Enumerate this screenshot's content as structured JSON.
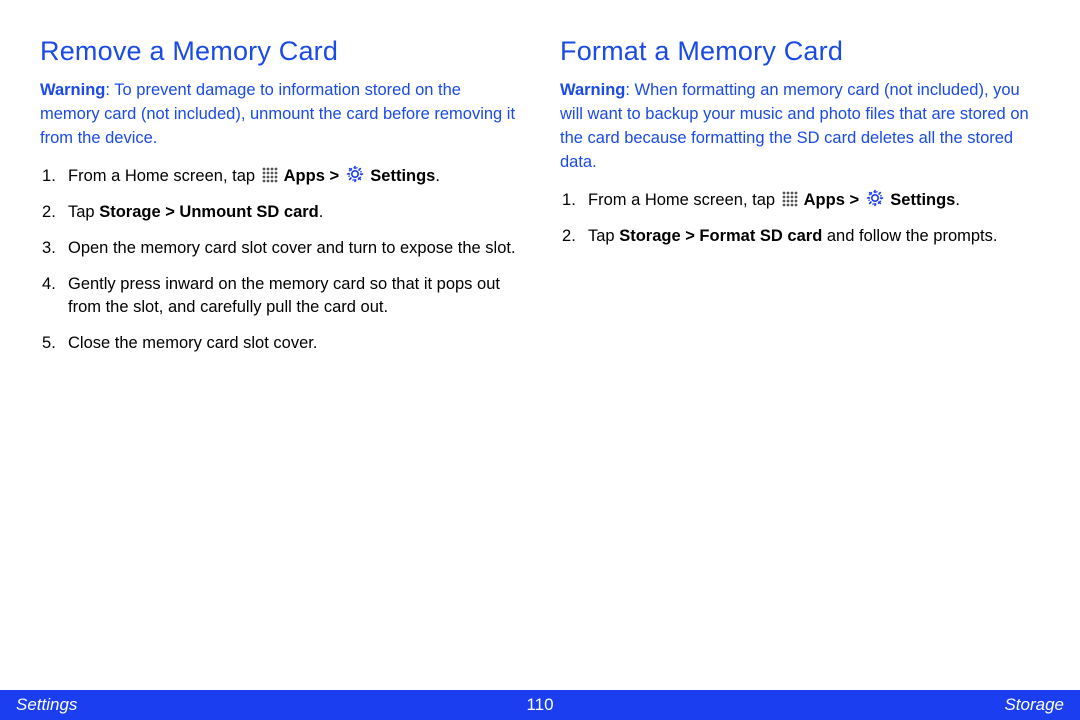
{
  "left": {
    "heading": "Remove a Memory Card",
    "warning_label": "Warning",
    "warning_text": ": To prevent damage to information stored on the memory card (not included), unmount the card before removing it from the device.",
    "steps": {
      "s1a": "From a Home screen, tap ",
      "s1b": " Apps > ",
      "s1c": " Settings",
      "s2a": "Tap ",
      "s2b": "Storage > Unmount SD card",
      "s3": "Open the memory card slot cover and turn to expose the slot.",
      "s4": "Gently press inward on the memory card so that it pops out from the slot, and carefully pull the card out.",
      "s5": "Close the memory card slot cover."
    }
  },
  "right": {
    "heading": "Format a Memory Card",
    "warning_label": "Warning",
    "warning_text": ": When formatting an memory card (not included), you will want to backup your music and photo files that are stored on the card because formatting the SD card deletes all the stored data.",
    "steps": {
      "s1a": "From a Home screen, tap ",
      "s1b": " Apps > ",
      "s1c": " Settings",
      "s2a": "Tap ",
      "s2b": "Storage > Format SD card",
      "s2c": " and follow the prompts."
    }
  },
  "footer": {
    "left": "Settings",
    "page": "110",
    "right": "Storage"
  }
}
